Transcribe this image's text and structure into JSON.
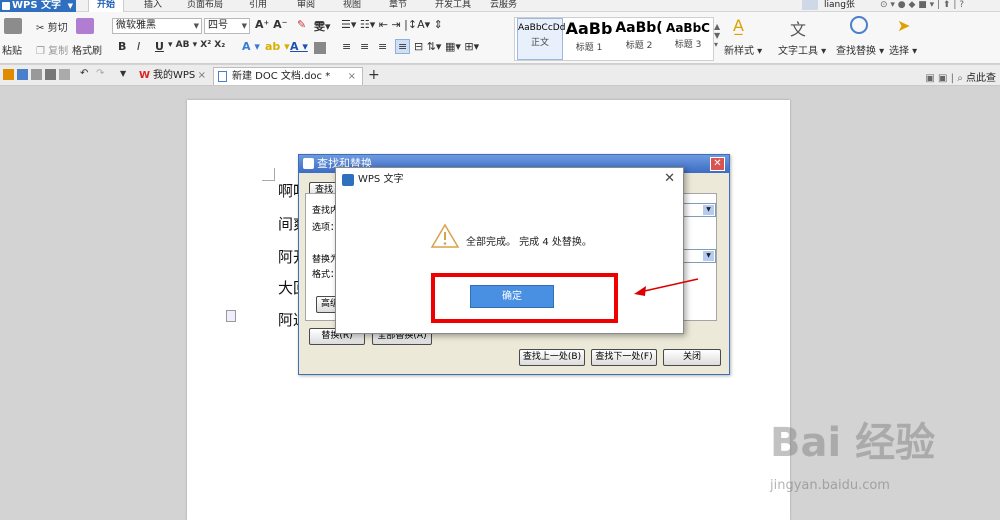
{
  "menubar": {
    "app_name": "WPS 文字",
    "tabs": [
      "开始",
      "插入",
      "页面布局",
      "引用",
      "审阅",
      "视图",
      "章节",
      "开发工具",
      "云服务"
    ],
    "user": "liang张"
  },
  "ribbon": {
    "paste": "粘贴",
    "cut": "剪切",
    "copy": "复制",
    "format_painter": "格式刷",
    "font_name": "微软雅黑",
    "font_size": "四号",
    "bold": "B",
    "italic": "I",
    "underline": "U",
    "styles": [
      {
        "sample": "AaBbCcDd",
        "name": "正文"
      },
      {
        "sample": "AaBb",
        "name": "标题 1"
      },
      {
        "sample": "AaBb(",
        "name": "标题 2"
      },
      {
        "sample": "AaBbC",
        "name": "标题 3"
      }
    ],
    "new_style": "新样式",
    "text_tools": "文字工具",
    "find_replace": "查找替换",
    "select": "选择"
  },
  "tabbar": {
    "tabs": [
      {
        "label": "我的WPS"
      },
      {
        "label": "新建 DOC 文档.doc *"
      }
    ],
    "search": "点此查"
  },
  "document": {
    "lines": [
      "啊呀",
      "间爽",
      "阿开",
      "大回",
      "阿达"
    ]
  },
  "find_replace": {
    "title": "查找和替换",
    "tab_find": "查找",
    "find_label": "查找内",
    "options_label": "选项：",
    "replace_label": "替换为",
    "format_label": "格式：",
    "advanced": "高级",
    "replace_btn": "替换(R)",
    "replace_all_btn": "全部替换(A)",
    "find_prev": "查找上一处(B)",
    "find_next": "查找下一处(F)",
    "close": "关闭"
  },
  "message_box": {
    "title": "WPS 文字",
    "message": "全部完成。 完成 4 处替换。",
    "ok": "确定"
  },
  "watermark": {
    "brand": "Bai 经验",
    "url": "jingyan.baidu.com"
  },
  "colors": {
    "accent": "#2f6fc0",
    "ok_button": "#4a90e2",
    "annotation": "#e00000"
  }
}
